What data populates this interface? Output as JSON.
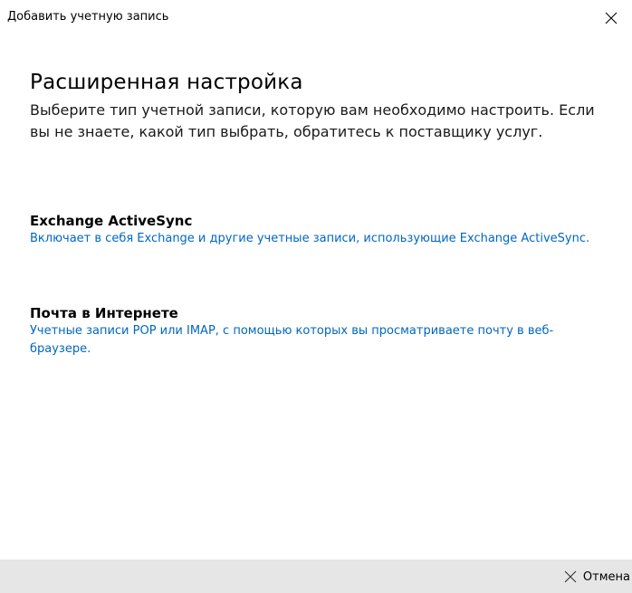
{
  "window": {
    "title": "Добавить учетную запись",
    "close_icon": "close-icon"
  },
  "main": {
    "title": "Расширенная настройка",
    "description": "Выберите тип учетной записи, которую вам необходимо настроить. Если вы не знаете, какой тип выбрать, обратитесь к поставщику услуг."
  },
  "options": [
    {
      "title": "Exchange ActiveSync",
      "description": "Включает в себя Exchange и другие учетные записи, использующие Exchange ActiveSync."
    },
    {
      "title": "Почта в Интернете",
      "description": "Учетные записи POP или IMAP, с помощью которых вы просматриваете почту в веб-браузере."
    }
  ],
  "footer": {
    "cancel_label": "Отмена",
    "cancel_icon": "close-icon"
  },
  "colors": {
    "link": "#0067c0",
    "footer_bg": "#e6e6e6",
    "background": "#ffffff"
  }
}
